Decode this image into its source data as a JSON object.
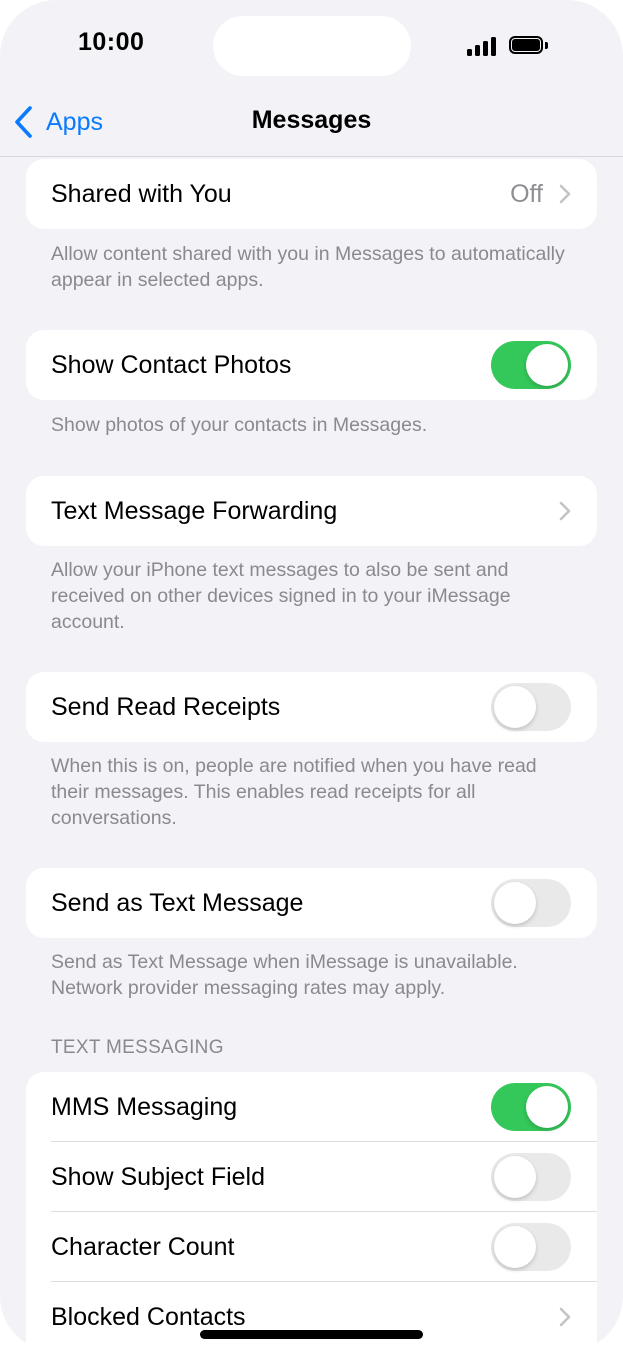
{
  "status_bar": {
    "time": "10:00"
  },
  "nav": {
    "back_label": "Apps",
    "title": "Messages"
  },
  "shared_with_you": {
    "label": "Shared with You",
    "value": "Off",
    "footer": "Allow content shared with you in Messages to automatically appear in selected apps."
  },
  "show_contact_photos": {
    "label": "Show Contact Photos",
    "on": true,
    "footer": "Show photos of your contacts in Messages."
  },
  "text_message_forwarding": {
    "label": "Text Message Forwarding",
    "footer": "Allow your iPhone text messages to also be sent and received on other devices signed in to your iMessage account."
  },
  "send_read_receipts": {
    "label": "Send Read Receipts",
    "on": false,
    "footer": "When this is on, people are notified when you have read their messages. This enables read receipts for all conversations."
  },
  "send_as_text_message": {
    "label": "Send as Text Message",
    "on": false,
    "footer": "Send as Text Message when iMessage is unavailable. Network provider messaging rates may apply."
  },
  "text_messaging": {
    "header": "TEXT MESSAGING",
    "mms_messaging": {
      "label": "MMS Messaging",
      "on": true
    },
    "show_subject_field": {
      "label": "Show Subject Field",
      "on": false
    },
    "character_count": {
      "label": "Character Count",
      "on": false
    },
    "blocked_contacts": {
      "label": "Blocked Contacts"
    }
  },
  "colors": {
    "accent": "#0a7aff",
    "toggle_on": "#34c759",
    "toggle_off": "#e9e9ea",
    "background": "#f2f2f7"
  }
}
